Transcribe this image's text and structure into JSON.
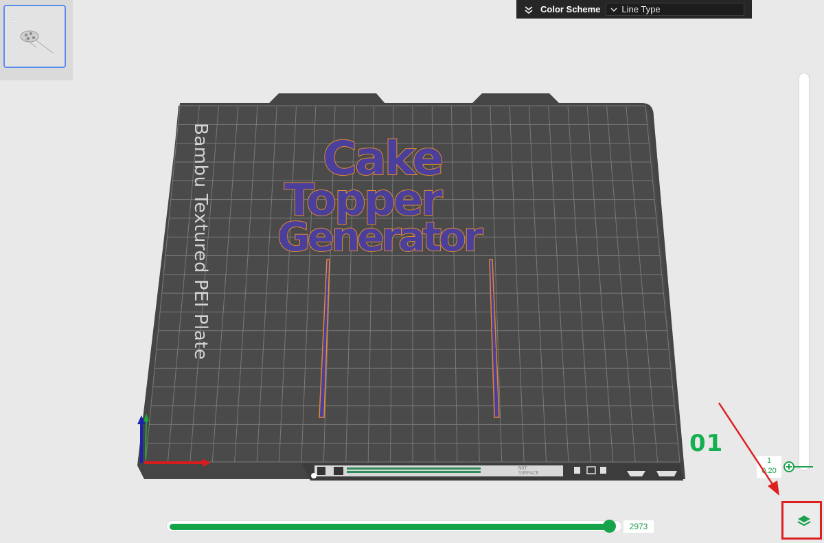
{
  "plate_list": {
    "active_plate_number": "1"
  },
  "color_scheme": {
    "label": "Color Scheme",
    "selected": "Line Type"
  },
  "bed": {
    "name": "Bambu Textured PEI Plate",
    "surface_text": "NOT SURFACE"
  },
  "model": {
    "lines": [
      "Cake",
      "Topper",
      "Generator"
    ]
  },
  "layer_slider": {
    "layer": "1",
    "height": "0.20"
  },
  "move_slider": {
    "value": "2973",
    "progress": 0.98
  },
  "annotation": {
    "step_label": "01"
  },
  "colors": {
    "accent_green": "#16a34a",
    "model_fill": "#4a3f9a",
    "model_outline": "#e08a2e",
    "bed": "#484848",
    "annotation_red": "#dc1f1f"
  }
}
